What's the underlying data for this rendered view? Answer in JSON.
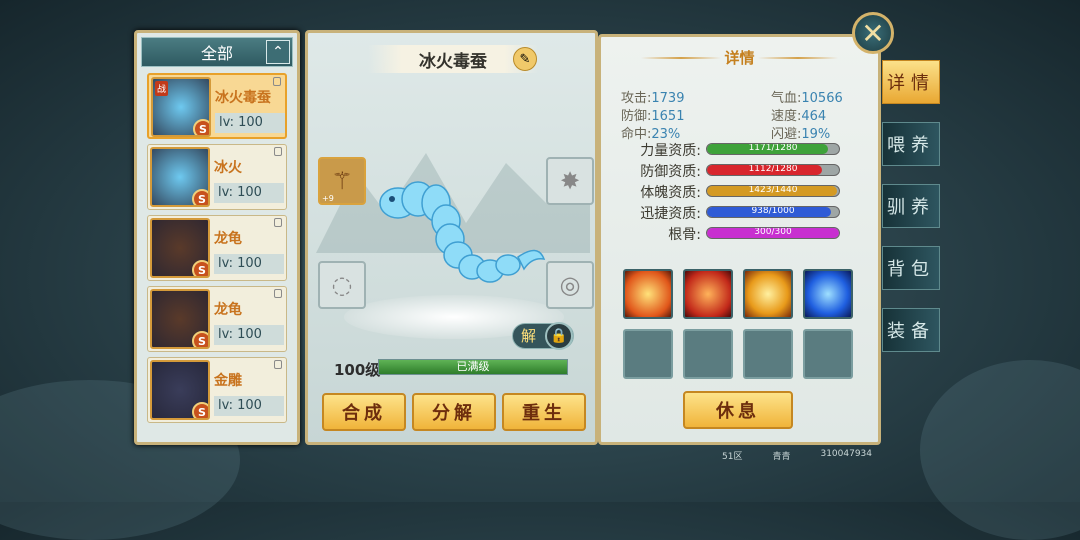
{
  "filter": {
    "label": "全部",
    "toggle": "⌃"
  },
  "pets": [
    {
      "name": "冰火毒蚕",
      "level": "lv: 100",
      "rank": "S",
      "tag": "战",
      "selected": true,
      "color": "#6ec9f0"
    },
    {
      "name": "冰火",
      "level": "lv: 100",
      "rank": "S",
      "color": "#6ec9f0"
    },
    {
      "name": "龙龟",
      "level": "lv: 100",
      "rank": "S",
      "color": "#5a3a2a"
    },
    {
      "name": "龙龟",
      "level": "lv: 100",
      "rank": "S",
      "color": "#5a3a2a"
    },
    {
      "name": "金雕",
      "level": "lv: 100",
      "rank": "S",
      "color": "#3a3d5a"
    }
  ],
  "center": {
    "pet_name": "冰火毒蚕",
    "rename_icon": "✎",
    "weapon_count": "+9",
    "unlock_label": "解",
    "lock_icon": "🔒",
    "level_label": "100级",
    "exp_text": "已满级",
    "exp_fraction": 1.0,
    "buttons": {
      "compose": "合成",
      "decompose": "分解",
      "rebirth": "重生"
    }
  },
  "detail": {
    "title": "详情",
    "stats": [
      {
        "label": "攻击:",
        "value": "1739"
      },
      {
        "label": "气血:",
        "value": "10566"
      },
      {
        "label": "防御:",
        "value": "1651"
      },
      {
        "label": "速度:",
        "value": "464"
      },
      {
        "label": "命中:",
        "value": "23%"
      },
      {
        "label": "闪避:",
        "value": "19%"
      }
    ],
    "qualities": [
      {
        "label": "力量资质:",
        "text": "1171/1280",
        "fraction": 0.915,
        "color": "#3ea23a"
      },
      {
        "label": "防御资质:",
        "text": "1112/1280",
        "fraction": 0.869,
        "color": "#d8262d"
      },
      {
        "label": "体魄资质:",
        "text": "1423/1440",
        "fraction": 0.988,
        "color": "#d49a23"
      },
      {
        "label": "迅捷资质:",
        "text": "938/1000",
        "fraction": 0.938,
        "color": "#2f5bd6"
      },
      {
        "label": "根骨:",
        "text": "300/300",
        "fraction": 1.0,
        "color": "#c82fd0"
      }
    ],
    "skills": [
      "fire-burst",
      "fire-orb",
      "flame-strike",
      "water-vortex"
    ],
    "rest_label": "休息"
  },
  "tabs": [
    "详情",
    "喂养",
    "驯养",
    "背包",
    "装备"
  ],
  "close_icon": "✕",
  "footer": {
    "zone": "51区",
    "name": "青青",
    "id": "310047934"
  }
}
